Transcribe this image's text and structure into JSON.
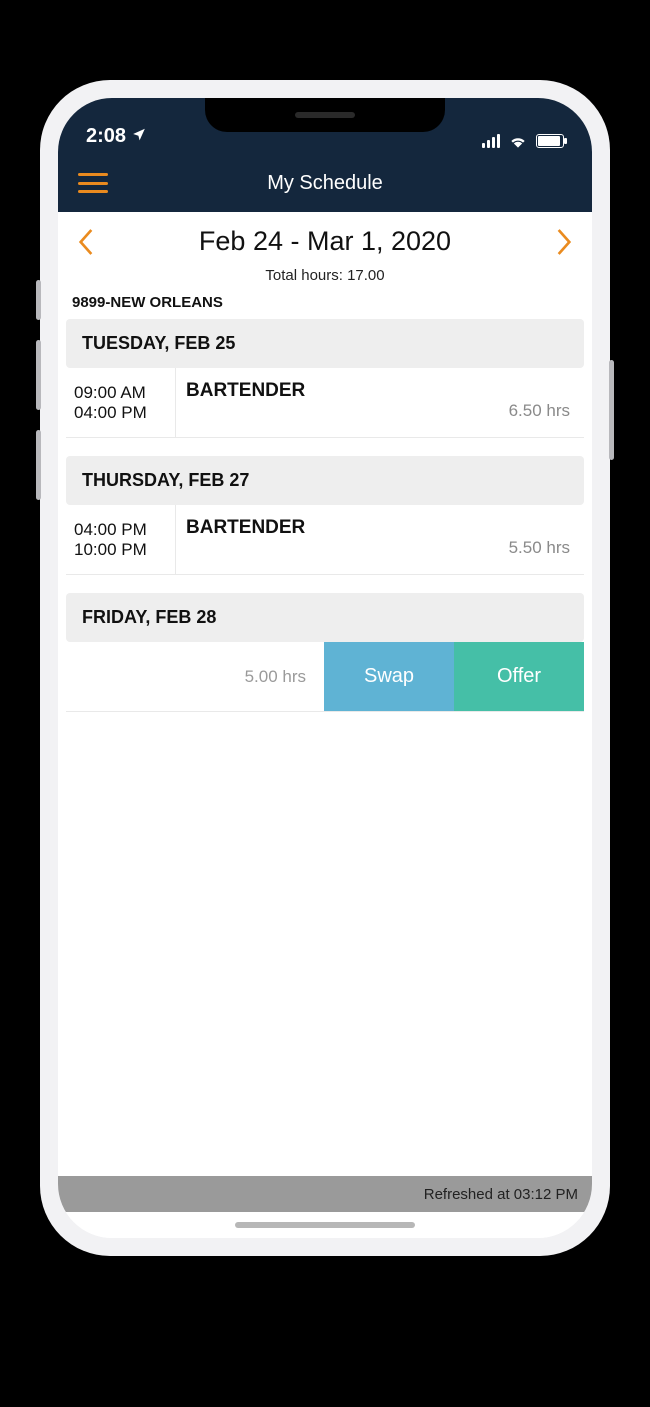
{
  "status": {
    "time": "2:08"
  },
  "header": {
    "title": "My Schedule"
  },
  "dateNav": {
    "range": "Feb 24 - Mar 1, 2020"
  },
  "summary": {
    "totalHours": "Total hours: 17.00",
    "location": "9899-NEW ORLEANS"
  },
  "days": [
    {
      "label": "TUESDAY, FEB 25",
      "shift": {
        "start": "09:00 AM",
        "end": "04:00 PM",
        "role": "BARTENDER",
        "hours": "6.50 hrs"
      }
    },
    {
      "label": "THURSDAY, FEB 27",
      "shift": {
        "start": "04:00 PM",
        "end": "10:00 PM",
        "role": "BARTENDER",
        "hours": "5.50 hrs"
      }
    },
    {
      "label": "FRIDAY, FEB 28",
      "actions": {
        "hours": "5.00 hrs",
        "swap": "Swap",
        "offer": "Offer"
      }
    }
  ],
  "footer": {
    "refreshed": "Refreshed at 03:12 PM"
  }
}
